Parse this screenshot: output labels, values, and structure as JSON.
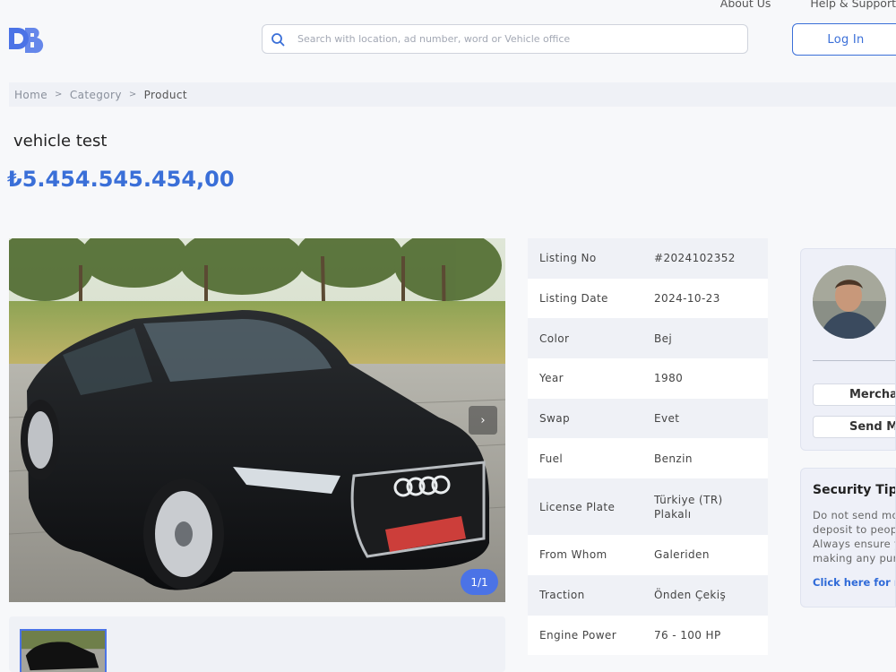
{
  "header": {
    "nav": [
      "About Us",
      "Help & Support"
    ],
    "search_placeholder": "Search with location, ad number, word or Vehicle office",
    "login_label": "Log In"
  },
  "breadcrumb": [
    "Home",
    "Category",
    "Product"
  ],
  "listing": {
    "title": "vehicle test",
    "price": "₺5.454.545.454,00",
    "image_counter": "1/1",
    "next_arrow": "›"
  },
  "specs": [
    {
      "label": "Listing No",
      "value": "#2024102352"
    },
    {
      "label": "Listing Date",
      "value": "2024-10-23"
    },
    {
      "label": "Color",
      "value": "Bej"
    },
    {
      "label": "Year",
      "value": "1980"
    },
    {
      "label": "Swap",
      "value": "Evet"
    },
    {
      "label": "Fuel",
      "value": "Benzin"
    },
    {
      "label": "License Plate",
      "value": "Türkiye (TR) Plakalı"
    },
    {
      "label": "From Whom",
      "value": "Galeriden"
    },
    {
      "label": "Traction",
      "value": "Önden Çekiş"
    },
    {
      "label": "Engine Power",
      "value": "76 - 100 HP"
    }
  ],
  "seller": {
    "button_1": "Merchant",
    "button_2": "Send Message"
  },
  "security": {
    "title": "Security Tips",
    "lines": [
      "Do not send money or",
      "deposit to people you",
      "Always ensure you are",
      "making any purchase."
    ],
    "link": "Click here for more"
  },
  "colors": {
    "accent": "#3a6fd8",
    "counter": "#4b73e6",
    "panel": "#eff1f6"
  }
}
